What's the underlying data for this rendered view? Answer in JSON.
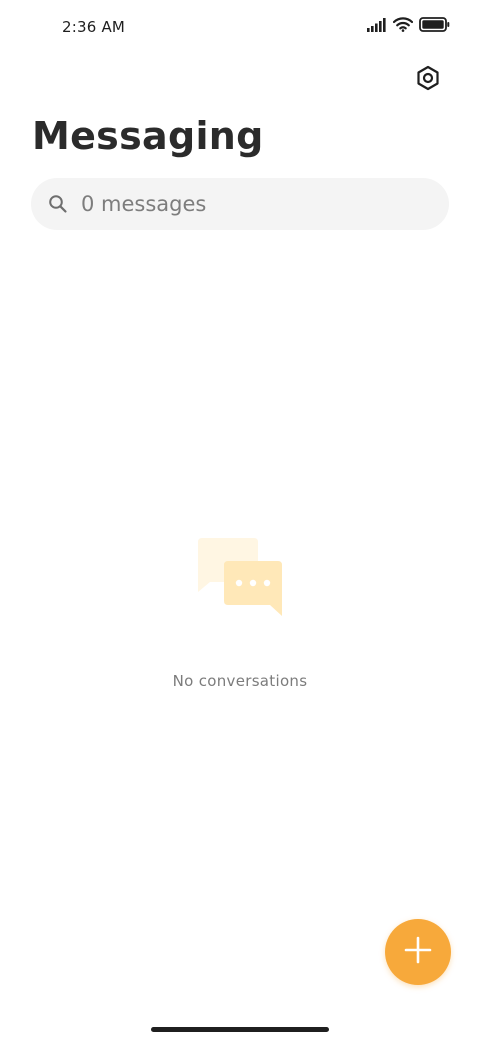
{
  "status_bar": {
    "time": "2:36 AM",
    "icons": [
      "signal-icon",
      "wifi-icon",
      "battery-icon"
    ]
  },
  "header": {
    "title": "Messaging",
    "settings_icon": "settings-icon"
  },
  "search": {
    "icon": "search-icon",
    "placeholder": "0 messages"
  },
  "empty_state": {
    "icon": "chat-bubbles-icon",
    "text": "No conversations"
  },
  "fab": {
    "icon": "plus-icon",
    "color": "#f7a93b"
  },
  "colors": {
    "accent": "#f7a93b",
    "search_bg": "#f4f4f4",
    "illustration_light": "#fff6e3",
    "illustration_main": "#ffe8b8"
  }
}
